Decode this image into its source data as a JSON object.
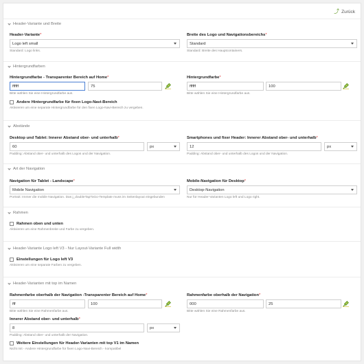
{
  "back_label": "Zurück",
  "colors": {
    "accent": "#6a9e2f",
    "focus": "#4a7fd4",
    "required": "#dd3333"
  },
  "sections": {
    "header_variant": {
      "title": "Header-Variante und Breite",
      "variant_label": "Header-Variante",
      "variant_value": "Logo left small",
      "variant_hint": "Standard: Logo links.",
      "width_label": "Breite des Logo und Navigationsbereichs",
      "width_value": "Standard",
      "width_hint": "Standard: Breite des Hauptcontainers."
    },
    "background": {
      "title": "Hintergrundfarben",
      "transp_label": "Hintergrundfarbe - Transparenter Bereich auf Home",
      "transp_color": "ffffff",
      "transp_opacity": "75",
      "transp_hint": "Bitte wählen Sie eine Hintergrundfarbe aus.",
      "bg_label": "Hintergrundfarbe",
      "bg_color": "ffffff",
      "bg_opacity": "100",
      "bg_hint": "Bitte wählen Sie eine Hintergrundfarbe aus.",
      "other_check_label": "Andere Hintergrundfarbe für fixen Logo-Navi-Bereich",
      "other_check_hint": "Aktivieren um eine separate Hintergrundfarbe für den fixen Logo-Navi-Bereich zu vergeben."
    },
    "spacing": {
      "title": "Abstände",
      "desktop_label": "Desktop und Tablet: Innerer Abstand ober- und unterhalb",
      "desktop_value": "60",
      "desktop_unit": "px",
      "desktop_hint": "Padding: Abstand ober- und unterhalb des Logos und der Navigation.",
      "phone_label": "Smartphones und fixer Header: Innerer Abstand ober- und unterhalb",
      "phone_value": "12",
      "phone_unit": "px",
      "phone_hint": "Padding: Abstand ober- und unterhalb des Logos und der Navigation."
    },
    "nav": {
      "title": "Art der Navigation",
      "tablet_label": "Navigation für Tablet - Landscape",
      "tablet_value": "Mobile Navigation",
      "tablet_hint": "Portrait: Immer die mobile Navigation. Das j_doubleTapToGo-Template muss im Seitenlayout eingebunden",
      "desktop_label": "Mobile-Navigation für Desktop",
      "desktop_value": "Desktop-Navigation",
      "desktop_hint": "Nur für Header-Varianten Logo left und Logo right."
    },
    "frame": {
      "title": "Rahmen",
      "check_label": "Rahmen oben und unten",
      "check_hint": "Aktivieren um eine Rahmenbreite und Farbe zu vergeben."
    },
    "logo_left_v3": {
      "title": "Header-Variante Logo left V3 - Nur Layout-Variante Full width",
      "check_label": "Einstellungen für Logo left V3",
      "check_hint": "Aktivieren um eine separate Farben zu vergeben."
    },
    "top_name": {
      "title": "Header-Varianten mit top im Namen",
      "frame_transp_label": "Rahmenfarbe oberhalb der Navigation -Transparenter Bereich auf Home",
      "frame_transp_color": "fff",
      "frame_transp_opacity": "100",
      "frame_transp_hint": "Bitte wählen Sie eine Rahmenfarbe aus.",
      "frame_label": "Rahmenfarbe oberhalb der Navigation",
      "frame_color": "000",
      "frame_opacity": "25",
      "frame_hint": "Bitte wählen Sie eine Rahmenfarbe aus.",
      "inner_label": "Innerer Abstand ober- und unterhalb",
      "inner_value": "8",
      "inner_unit": "px",
      "inner_hint": "Padding: Abstand ober- und unterhalb der Navigation.",
      "more_check_label": "Weitere Einstellungen für Header-Varianten mit top V1 im Namen",
      "more_check_hint": "Nicht mit - Andere Hintergrundfarbe für fixen Logo-Navi-Bereich - kompatibel"
    }
  }
}
